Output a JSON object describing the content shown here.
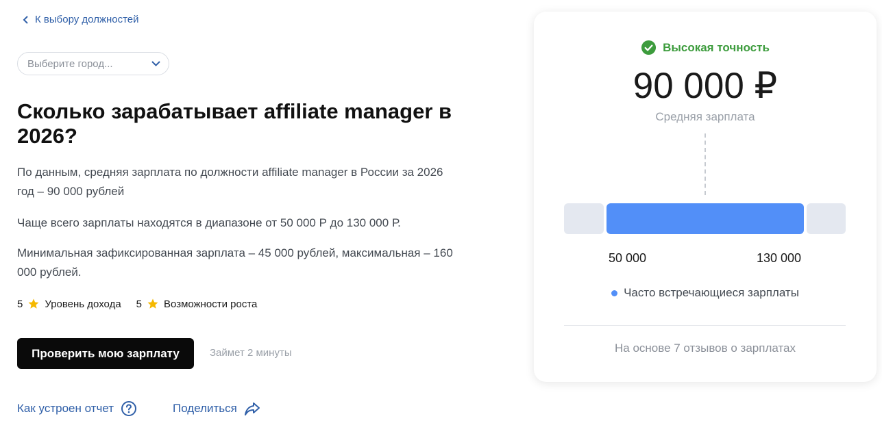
{
  "nav": {
    "back_label": "К выбору должностей"
  },
  "city_select": {
    "placeholder": "Выберите город..."
  },
  "title": "Сколько зарабатывает affiliate manager в 2026?",
  "paragraphs": {
    "p1": "По данным, средняя зарплата по должности affiliate manager в России за 2026 год – 90 000 рублей",
    "p2": "Чаще всего зарплаты находятся в диапазоне от 50 000 Р до 130 000 Р.",
    "p3": "Минимальная зафиксированная зарплата – 45 000 рублей, максимальная – 160 000 рублей."
  },
  "ratings": [
    {
      "score": "5",
      "label": "Уровень дохода",
      "icon": "star-icon"
    },
    {
      "score": "5",
      "label": "Возможности роста",
      "icon": "star-icon"
    }
  ],
  "cta": {
    "button_label": "Проверить мою зарплату",
    "hint": "Займет 2 минуты"
  },
  "footer": {
    "how_label": "Как устроен отчет",
    "share_label": "Поделиться"
  },
  "card": {
    "accuracy_label": "Высокая точность",
    "salary_value": "90 000 ₽",
    "salary_caption": "Средняя зарплата",
    "range_min": "50 000",
    "range_max": "130 000",
    "legend_label": "Часто встречающиеся зарплаты",
    "reviews_label": "На основе 7 отзывов о зарплатах"
  },
  "colors": {
    "accent": "#528ff8",
    "link": "#2f5fa8",
    "success": "#3d9c3d",
    "star": "#f5b800",
    "button": "#0a0a0a"
  }
}
